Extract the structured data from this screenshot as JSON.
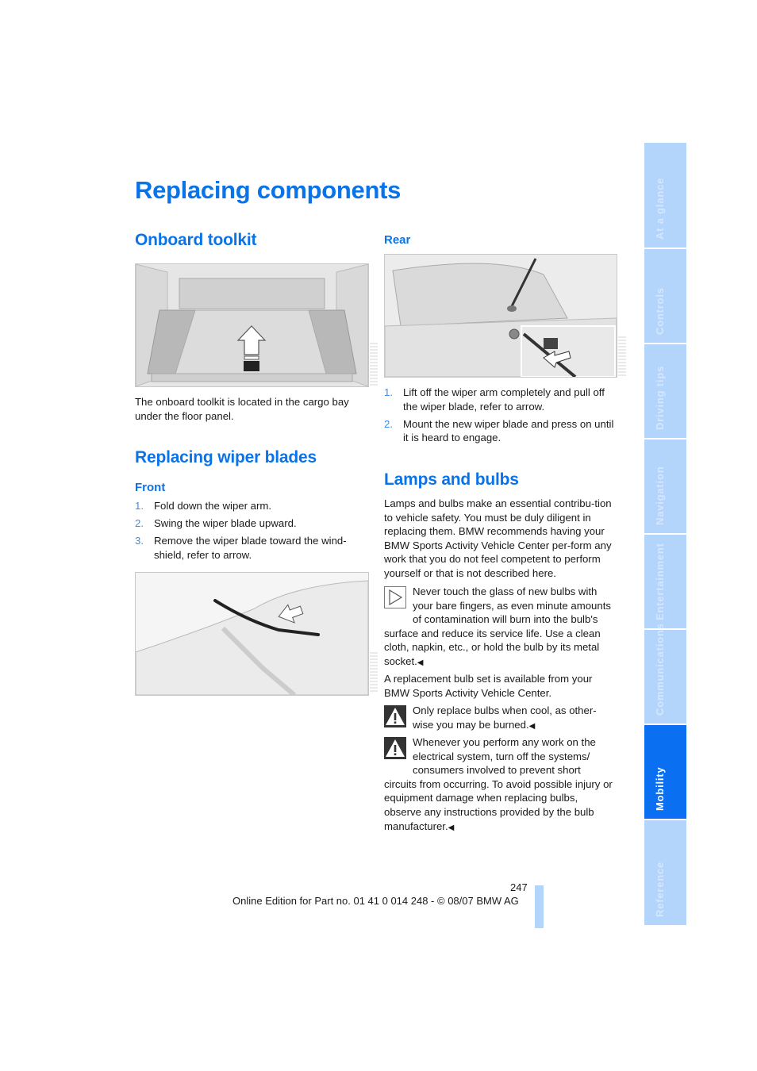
{
  "page": {
    "title": "Replacing components",
    "page_number": "247",
    "footer": "Online Edition for Part no. 01 41 0 014 248 - © 08/07 BMW AG"
  },
  "colors": {
    "accent": "#0a73e8",
    "tab_inactive": "#b3d4fb",
    "tab_active": "#0a6ff0"
  },
  "side_tabs": [
    {
      "label": "At a glance",
      "active": false
    },
    {
      "label": "Controls",
      "active": false
    },
    {
      "label": "Driving tips",
      "active": false
    },
    {
      "label": "Navigation",
      "active": false
    },
    {
      "label": "Entertainment",
      "active": false
    },
    {
      "label": "Communications",
      "active": false
    },
    {
      "label": "Mobility",
      "active": true
    },
    {
      "label": "Reference",
      "active": false
    }
  ],
  "onboard_toolkit": {
    "heading": "Onboard toolkit",
    "figure": "cargo-bay-illustration",
    "text": "The onboard toolkit is located in the cargo bay under the floor panel."
  },
  "wiper_blades": {
    "heading": "Replacing wiper blades",
    "front": {
      "heading": "Front",
      "steps": [
        {
          "num": "1.",
          "text": "Fold down the wiper arm."
        },
        {
          "num": "2.",
          "text": "Swing the wiper blade upward."
        },
        {
          "num": "3.",
          "text": "Remove the wiper blade toward the wind-shield, refer to arrow."
        }
      ],
      "figure": "front-wiper-illustration"
    },
    "rear": {
      "heading": "Rear",
      "figure": "rear-wiper-illustration",
      "steps": [
        {
          "num": "1.",
          "text": "Lift off the wiper arm completely and pull off the wiper blade, refer to arrow."
        },
        {
          "num": "2.",
          "text": "Mount the new wiper blade and press on until it is heard to engage."
        }
      ]
    }
  },
  "lamps": {
    "heading": "Lamps and bulbs",
    "intro": "Lamps and bulbs make an essential contribu-tion to vehicle safety. You must be duly diligent in replacing them. BMW recommends having your BMW Sports Activity Vehicle Center per-form any work that you do not feel competent to perform yourself or that is not described here.",
    "note": "Never touch the glass of new bulbs with your bare fingers, as even minute amounts of contamination will burn into the bulb's surface and reduce its service life. Use a clean cloth, napkin, etc., or hold the bulb by its metal socket.",
    "replacement": "A replacement bulb set is available from your BMW Sports Activity Vehicle Center.",
    "warning1": "Only replace bulbs when cool, as other-wise you may be burned.",
    "warning2": "Whenever you perform any work on the electrical system, turn off the systems/ consumers involved to prevent short circuits from occurring. To avoid possible injury or equipment damage when replacing bulbs, observe any instructions provided by the bulb manufacturer.",
    "end_marker": "◀"
  }
}
